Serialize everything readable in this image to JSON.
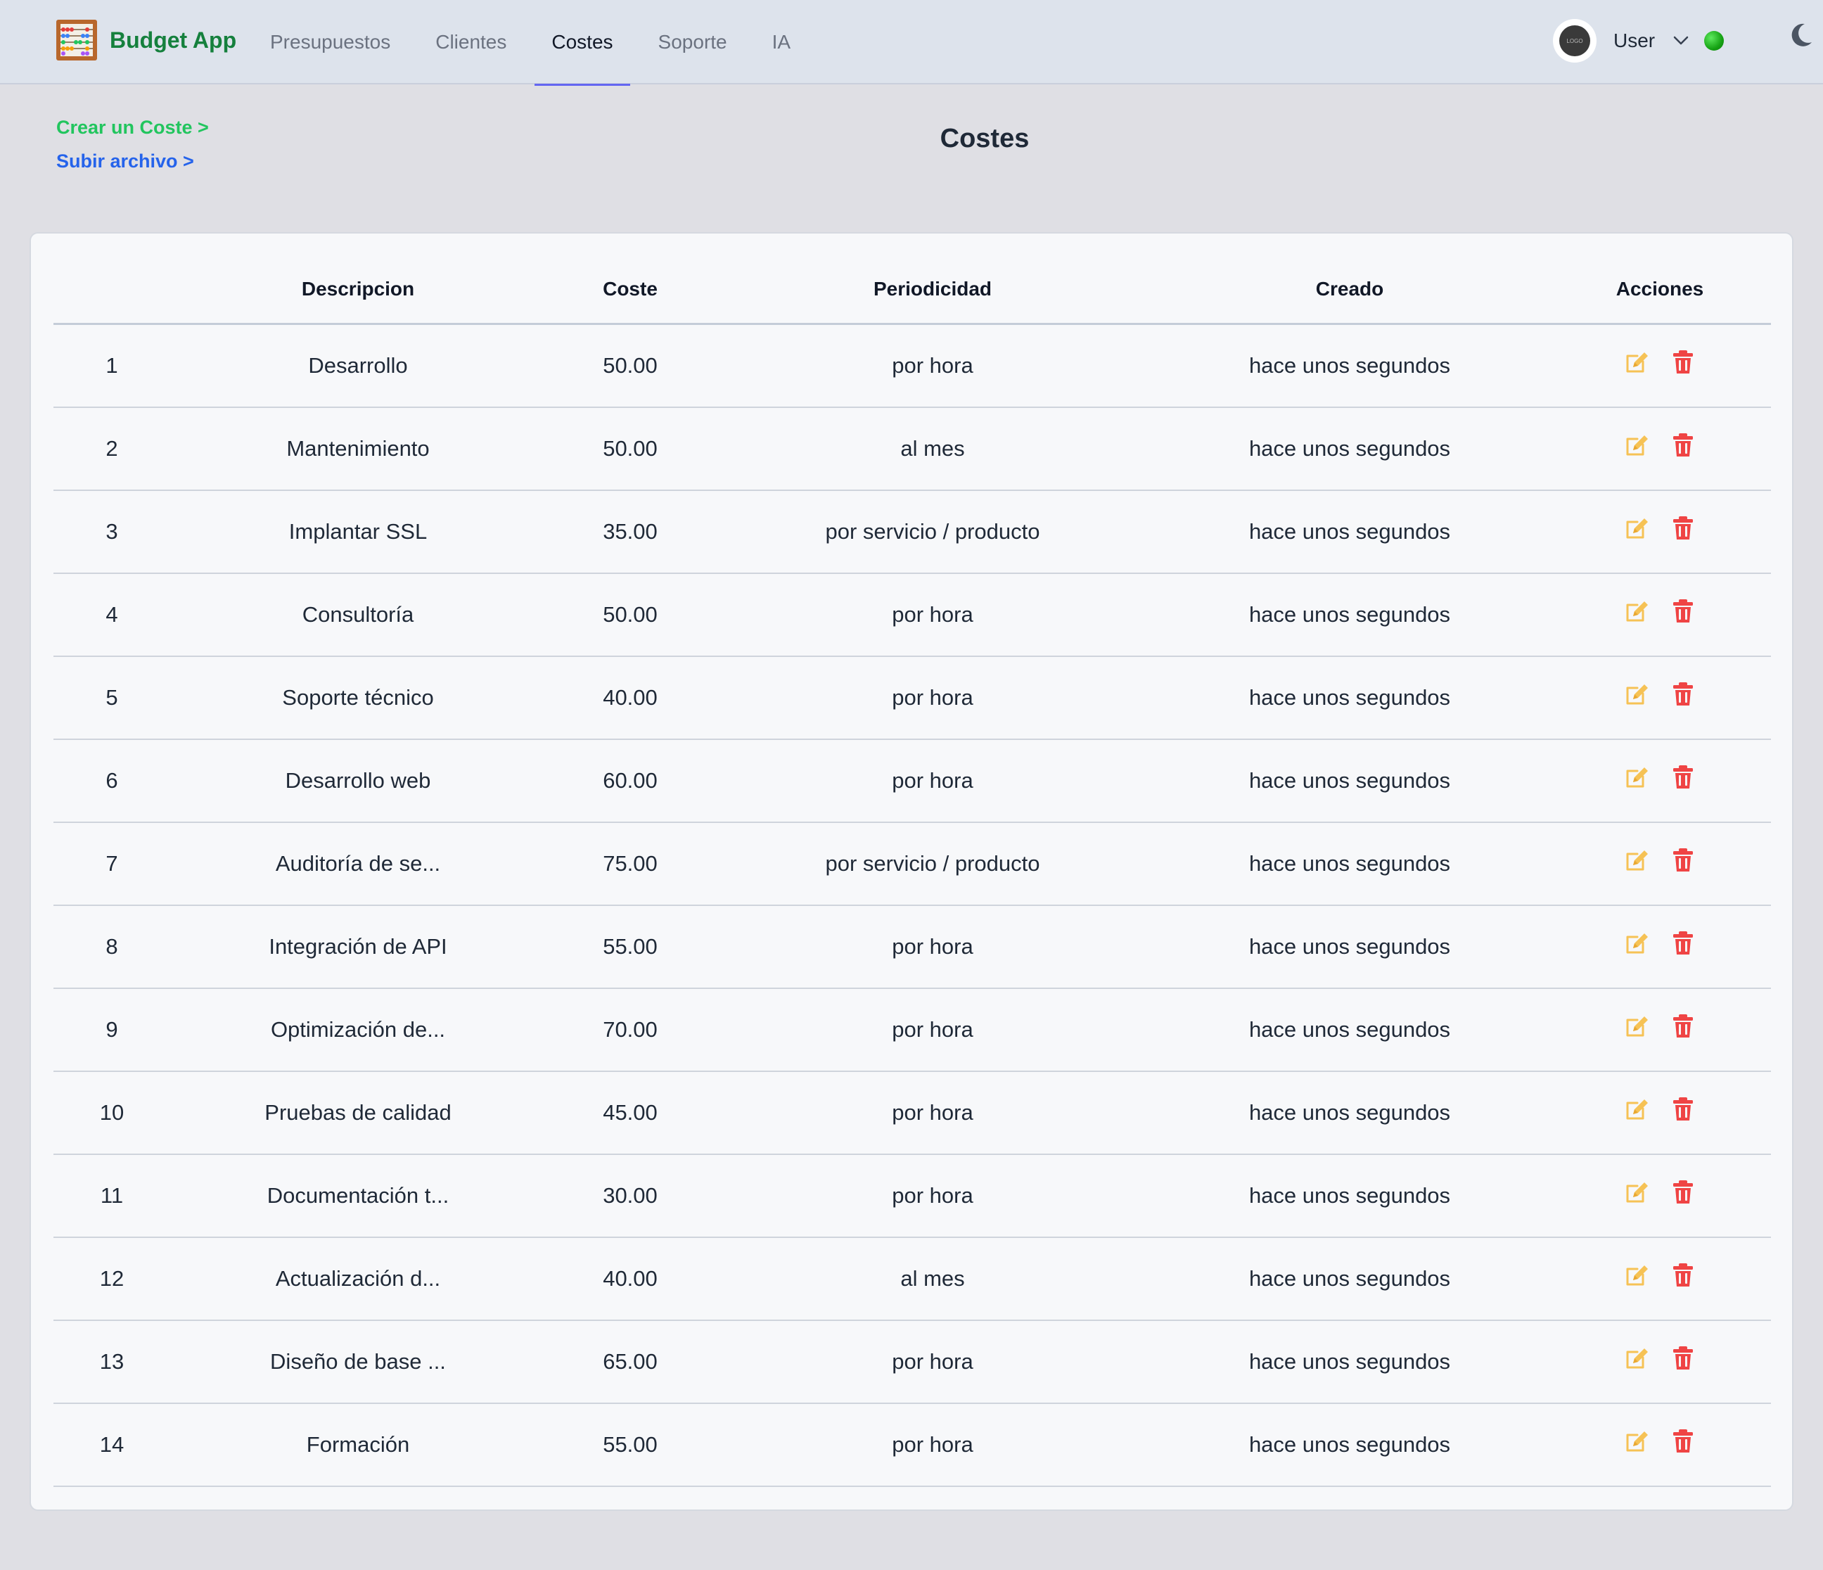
{
  "brand": {
    "name": "Budget App"
  },
  "nav": {
    "items": [
      {
        "label": "Presupuestos",
        "active": false
      },
      {
        "label": "Clientes",
        "active": false
      },
      {
        "label": "Costes",
        "active": true
      },
      {
        "label": "Soporte",
        "active": false
      },
      {
        "label": "IA",
        "active": false
      }
    ]
  },
  "user": {
    "name": "User",
    "avatar_text": "LOGO",
    "status_color": "#16a314"
  },
  "page": {
    "title": "Costes",
    "create_link": "Crear un Coste >",
    "upload_link": "Subir archivo >"
  },
  "table": {
    "headers": {
      "index": "",
      "description": "Descripcion",
      "cost": "Coste",
      "periodicity": "Periodicidad",
      "created": "Creado",
      "actions": "Acciones"
    },
    "rows": [
      {
        "index": "1",
        "description": "Desarrollo",
        "cost": "50.00",
        "periodicity": "por hora",
        "created": "hace unos segundos"
      },
      {
        "index": "2",
        "description": "Mantenimiento",
        "cost": "50.00",
        "periodicity": "al mes",
        "created": "hace unos segundos"
      },
      {
        "index": "3",
        "description": "Implantar SSL",
        "cost": "35.00",
        "periodicity": "por servicio / producto",
        "created": "hace unos segundos"
      },
      {
        "index": "4",
        "description": "Consultoría",
        "cost": "50.00",
        "periodicity": "por hora",
        "created": "hace unos segundos"
      },
      {
        "index": "5",
        "description": "Soporte técnico",
        "cost": "40.00",
        "periodicity": "por hora",
        "created": "hace unos segundos"
      },
      {
        "index": "6",
        "description": "Desarrollo web",
        "cost": "60.00",
        "periodicity": "por hora",
        "created": "hace unos segundos"
      },
      {
        "index": "7",
        "description": "Auditoría de se...",
        "cost": "75.00",
        "periodicity": "por servicio / producto",
        "created": "hace unos segundos"
      },
      {
        "index": "8",
        "description": "Integración de API",
        "cost": "55.00",
        "periodicity": "por hora",
        "created": "hace unos segundos"
      },
      {
        "index": "9",
        "description": "Optimización de...",
        "cost": "70.00",
        "periodicity": "por hora",
        "created": "hace unos segundos"
      },
      {
        "index": "10",
        "description": "Pruebas de calidad",
        "cost": "45.00",
        "periodicity": "por hora",
        "created": "hace unos segundos"
      },
      {
        "index": "11",
        "description": "Documentación t...",
        "cost": "30.00",
        "periodicity": "por hora",
        "created": "hace unos segundos"
      },
      {
        "index": "12",
        "description": "Actualización d...",
        "cost": "40.00",
        "periodicity": "al mes",
        "created": "hace unos segundos"
      },
      {
        "index": "13",
        "description": "Diseño de base ...",
        "cost": "65.00",
        "periodicity": "por hora",
        "created": "hace unos segundos"
      },
      {
        "index": "14",
        "description": "Formación",
        "cost": "55.00",
        "periodicity": "por hora",
        "created": "hace unos segundos"
      }
    ],
    "row_actions": [
      {
        "icon": "edit-icon",
        "color": "#f6c255"
      },
      {
        "icon": "trash-icon",
        "color": "#ef4444"
      }
    ]
  },
  "icons": {
    "brand_logo": "abacus-icon",
    "user_menu": "chevron-down-icon",
    "theme_toggle": "moon-icon"
  },
  "colors": {
    "brand_green": "#15803d",
    "create_link": "#22c55e",
    "upload_link": "#2563eb",
    "nav_active_underline": "#6366f1"
  }
}
